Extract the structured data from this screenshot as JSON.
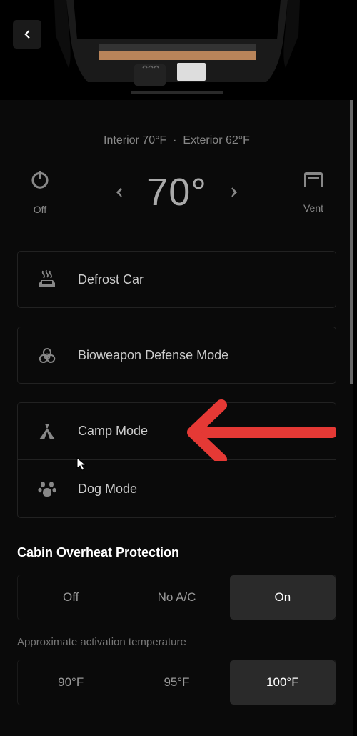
{
  "header": {
    "interior_text": "Interior 70°F",
    "exterior_text": "Exterior 62°F"
  },
  "climate": {
    "off_label": "Off",
    "vent_label": "Vent",
    "temperature": 70,
    "temperature_display": "70°"
  },
  "options": [
    {
      "id": "defrost",
      "label": "Defrost Car"
    },
    {
      "id": "bioweapon",
      "label": "Bioweapon Defense Mode"
    },
    {
      "id": "camp",
      "label": "Camp Mode"
    },
    {
      "id": "dog",
      "label": "Dog Mode"
    }
  ],
  "cabin_overheat": {
    "title": "Cabin Overheat Protection",
    "options": [
      "Off",
      "No A/C",
      "On"
    ],
    "selected": "On",
    "temp_label": "Approximate activation temperature",
    "temp_options": [
      "90°F",
      "95°F",
      "100°F"
    ],
    "temp_selected": "100°F"
  },
  "annotation": {
    "type": "arrow",
    "color": "#e53935",
    "target": "camp-mode"
  }
}
